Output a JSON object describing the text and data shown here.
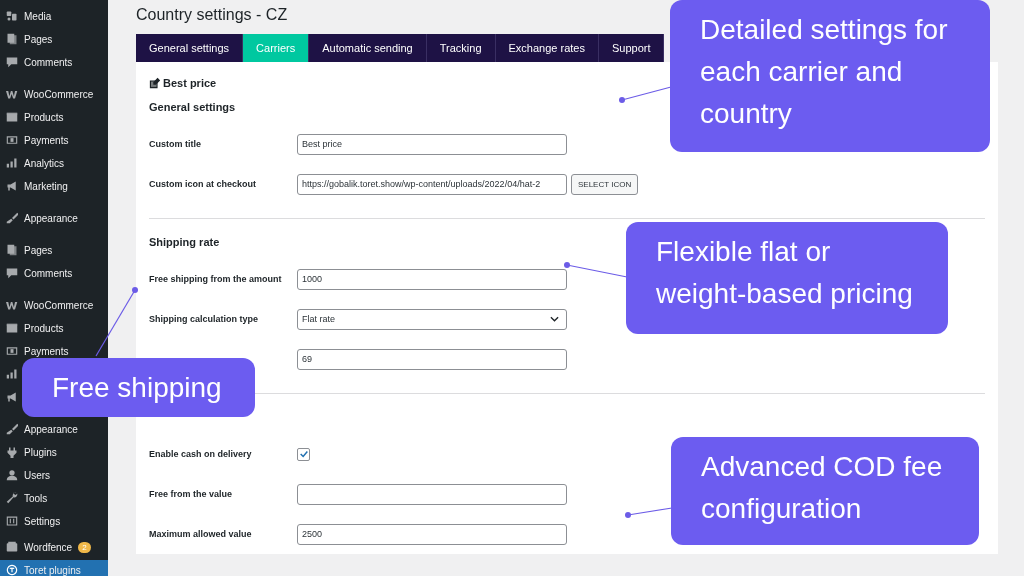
{
  "sidebar": {
    "groups": [
      [
        {
          "label": "Media",
          "selected": false
        },
        {
          "label": "Pages",
          "selected": false
        },
        {
          "label": "Comments",
          "selected": false
        }
      ],
      [
        {
          "label": "WooCommerce",
          "selected": false
        },
        {
          "label": "Products",
          "selected": false
        },
        {
          "label": "Payments",
          "selected": false
        },
        {
          "label": "Analytics",
          "selected": false
        },
        {
          "label": "Marketing",
          "selected": false
        }
      ],
      [
        {
          "label": "Appearance",
          "selected": false
        }
      ],
      [
        {
          "label": "Pages",
          "selected": false
        },
        {
          "label": "Comments",
          "selected": false
        }
      ],
      [
        {
          "label": "WooCommerce",
          "selected": false
        },
        {
          "label": "Products",
          "selected": false
        },
        {
          "label": "Payments",
          "selected": false
        },
        {
          "selected": false
        },
        {
          "selected": false
        }
      ],
      [
        {
          "label": "Appearance",
          "selected": false
        },
        {
          "label": "Plugins",
          "selected": false
        },
        {
          "label": "Users",
          "selected": false
        },
        {
          "label": "Tools",
          "selected": false
        },
        {
          "label": "Settings",
          "selected": false
        }
      ],
      [
        {
          "label": "Wordfence",
          "badge": "2",
          "selected": false
        },
        {
          "label": "Toret plugins",
          "selected": true
        }
      ]
    ]
  },
  "page": {
    "title": "Country settings - CZ"
  },
  "tabs": [
    {
      "label": "General settings",
      "selected": false
    },
    {
      "label": "Carriers",
      "selected": true
    },
    {
      "label": "Automatic sending",
      "selected": false
    },
    {
      "label": "Tracking",
      "selected": false
    },
    {
      "label": "Exchange rates",
      "selected": false
    },
    {
      "label": "Support",
      "selected": false
    }
  ],
  "carrier": {
    "name": "Best price"
  },
  "sections": [
    {
      "title": "General settings",
      "fields": [
        {
          "kind": "text",
          "label": "Custom title",
          "value": "Best price"
        },
        {
          "kind": "text",
          "label": "Custom icon at checkout",
          "value": "https://gobalik.toret.show/wp-content/uploads/2022/04/hat-2",
          "button": "SELECT ICON"
        }
      ]
    },
    {
      "title": "Shipping rate",
      "fields": [
        {
          "kind": "text",
          "label": "Free shipping from the amount",
          "value": "1000"
        },
        {
          "kind": "select",
          "label": "Shipping calculation type",
          "value": "Flat rate"
        },
        {
          "kind": "text",
          "value": "69"
        }
      ]
    },
    {
      "fields": [
        {
          "kind": "checkbox",
          "label": "Enable cash on delivery",
          "checked": true
        },
        {
          "kind": "text",
          "label": "Free from the value"
        },
        {
          "kind": "text",
          "label": "Maximum allowed value",
          "value": "2500"
        }
      ]
    }
  ],
  "callouts": [
    {
      "text": "Detailed settings for each carrier and country"
    },
    {
      "text": "Flexible flat or weight-based pricing"
    },
    {
      "text": "Free shipping"
    },
    {
      "text": "Advanced COD fee configuration"
    }
  ]
}
